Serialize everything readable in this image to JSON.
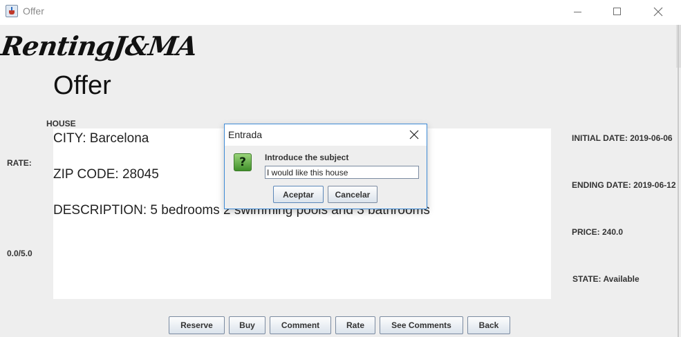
{
  "window": {
    "title": "Offer"
  },
  "app": {
    "logo": "RentingJ&MA",
    "page_title": "Offer",
    "section_label": "HOUSE",
    "rate_label": "RATE:",
    "rating_value": "0.0/5.0"
  },
  "details": {
    "city": "CITY: Barcelona",
    "zip_code": "ZIP CODE: 28045",
    "description": "DESCRIPTION: 5 bedrooms 2 swimming pools and 3 bathrooms"
  },
  "info": {
    "initial_date": "INITIAL DATE: 2019-06-06",
    "ending_date": "ENDING DATE: 2019-06-12",
    "price": "PRICE: 240.0",
    "state": "STATE: Available"
  },
  "actions": {
    "reserve": "Reserve",
    "buy": "Buy",
    "comment": "Comment",
    "rate": "Rate",
    "see_comments": "See Comments",
    "back": "Back"
  },
  "dialog": {
    "title": "Entrada",
    "icon": "question-icon",
    "icon_glyph": "?",
    "message": "Introduce the subject",
    "input_value": "I would like this house",
    "ok_label": "Aceptar",
    "cancel_label": "Cancelar"
  },
  "colors": {
    "window_bg": "#eeeeee",
    "dialog_border": "#3d8ad6",
    "question_icon": "#4f9a33"
  }
}
